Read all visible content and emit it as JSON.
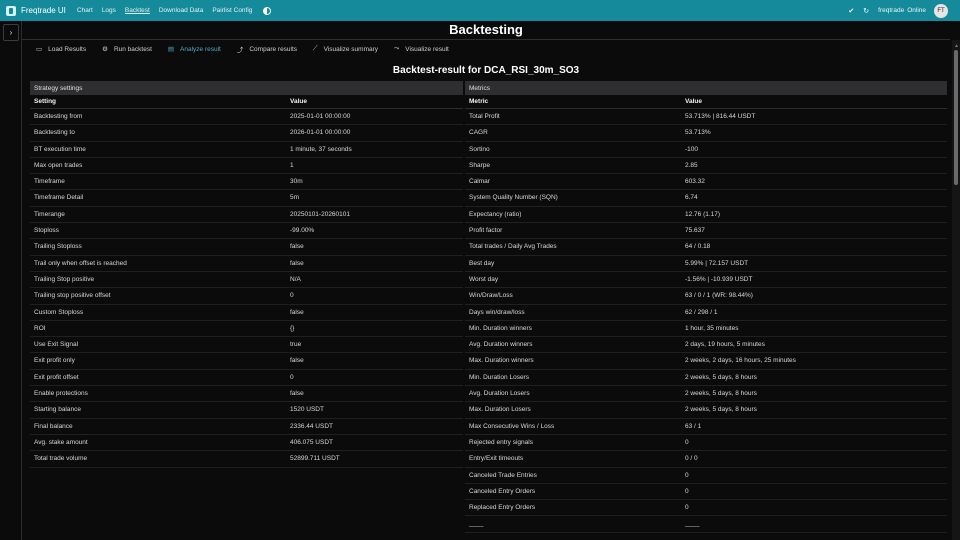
{
  "topbar": {
    "brand": "Freqtrade UI",
    "nav": [
      "Chart",
      "Logs",
      "Backtest",
      "Download Data",
      "Pairlist Config"
    ],
    "active_nav": "Backtest",
    "bot_name": "freqtrade",
    "bot_status": "Online",
    "avatar_initials": "FT",
    "accent_color": "#158a9a"
  },
  "page": {
    "title": "Backtesting",
    "result_title": "Backtest-result for DCA_RSI_30m_SO3"
  },
  "tabs": [
    {
      "label": "Load Results",
      "icon": "folder-icon"
    },
    {
      "label": "Run backtest",
      "icon": "gear-icon"
    },
    {
      "label": "Analyze result",
      "icon": "chart-icon"
    },
    {
      "label": "Compare results",
      "icon": "trend-icon"
    },
    {
      "label": "Visualize summary",
      "icon": "line-chart-icon"
    },
    {
      "label": "Visualize result",
      "icon": "area-chart-icon"
    }
  ],
  "strategy": {
    "header": "Strategy settings",
    "col_setting": "Setting",
    "col_value": "Value",
    "rows": [
      [
        "Backtesting from",
        "2025-01-01 00:00:00"
      ],
      [
        "Backtesting to",
        "2026-01-01 00:00:00"
      ],
      [
        "BT execution time",
        "1 minute, 37 seconds"
      ],
      [
        "Max open trades",
        "1"
      ],
      [
        "Timeframe",
        "30m"
      ],
      [
        "Timeframe Detail",
        "5m"
      ],
      [
        "Timerange",
        "20250101-20260101"
      ],
      [
        "Stoploss",
        "-99.00%"
      ],
      [
        "Trailing Stoploss",
        "false"
      ],
      [
        "Trail only when offset is reached",
        "false"
      ],
      [
        "Trailing Stop positive",
        "N/A"
      ],
      [
        "Trailing stop positive offset",
        "0"
      ],
      [
        "Custom Stoploss",
        "false"
      ],
      [
        "ROI",
        "{}"
      ],
      [
        "Use Exit Signal",
        "true"
      ],
      [
        "Exit profit only",
        "false"
      ],
      [
        "Exit profit offset",
        "0"
      ],
      [
        "Enable protections",
        "false"
      ],
      [
        "Starting balance",
        "1520 USDT"
      ],
      [
        "Final balance",
        "2336.44 USDT"
      ],
      [
        "Avg. stake amount",
        "406.075 USDT"
      ],
      [
        "Total trade volume",
        "52899.711 USDT"
      ]
    ]
  },
  "metrics": {
    "header": "Metrics",
    "col_metric": "Metric",
    "col_value": "Value",
    "rows": [
      [
        "Total Profit",
        "53.713% | 816.44 USDT"
      ],
      [
        "CAGR",
        "53.713%"
      ],
      [
        "Sortino",
        "-100"
      ],
      [
        "Sharpe",
        "2.85"
      ],
      [
        "Calmar",
        "603.32"
      ],
      [
        "System Quality Number (SQN)",
        "6.74"
      ],
      [
        "Expectancy (ratio)",
        "12.76 (1.17)"
      ],
      [
        "Profit factor",
        "75.637"
      ],
      [
        "Total trades / Daily Avg Trades",
        "64 / 0.18"
      ],
      [
        "Best day",
        "5.99% | 72.157 USDT"
      ],
      [
        "Worst day",
        "-1.56% | -10.939 USDT"
      ],
      [
        "Win/Draw/Loss",
        "63 / 0 / 1 (WR: 98.44%)"
      ],
      [
        "Days win/draw/loss",
        "62 / 298 / 1"
      ],
      [
        "Min. Duration winners",
        "1 hour, 35 minutes"
      ],
      [
        "Avg. Duration winners",
        "2 days, 19 hours, 5 minutes"
      ],
      [
        "Max. Duration winners",
        "2 weeks, 2 days, 16 hours, 25 minutes"
      ],
      [
        "Min. Duration Losers",
        "2 weeks, 5 days, 8 hours"
      ],
      [
        "Avg. Duration Losers",
        "2 weeks, 5 days, 8 hours"
      ],
      [
        "Max. Duration Losers",
        "2 weeks, 5 days, 8 hours"
      ],
      [
        "Max Consecutive Wins / Loss",
        "63 / 1"
      ],
      [
        "Rejected entry signals",
        "0"
      ],
      [
        "Entry/Exit timeouts",
        "0 / 0"
      ],
      [
        "Canceled Trade Entries",
        "0"
      ],
      [
        "Canceled Entry Orders",
        "0"
      ],
      [
        "Replaced Entry Orders",
        "0"
      ],
      [
        "____",
        "____"
      ]
    ]
  }
}
